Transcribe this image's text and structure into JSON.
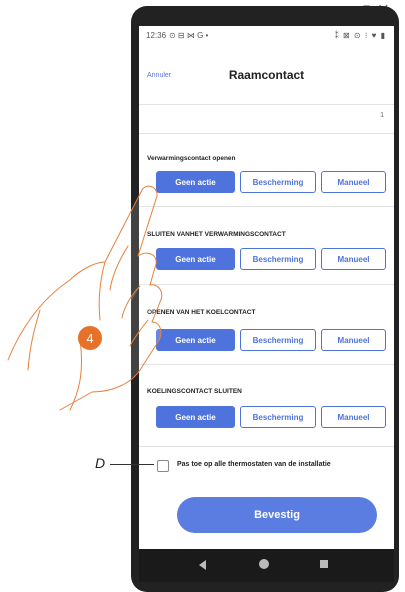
{
  "topbar": {
    "icons_text": "⧉ ✕"
  },
  "statusbar": {
    "time": "12:36",
    "left_icons": "⊙ ⊟ ⋈ G •",
    "right_icons": "⁑ ⊠ ⊙ ⁝ ♥ ▮"
  },
  "header": {
    "cancel_label": "Annuler",
    "title": "Raamcontact"
  },
  "device_number": "1",
  "sections": [
    {
      "label": "Verwarmingscontact openen",
      "options": [
        "Geen actie",
        "Bescherming",
        "Manueel"
      ],
      "selected": "Geen actie"
    },
    {
      "label": "SLUITEN VANHET VERWARMINGSCONTACT",
      "options": [
        "Geen actie",
        "Bescherming",
        "Manueel"
      ],
      "selected": "Geen actie"
    },
    {
      "label": "OPENEN VAN HET KOELCONTACT",
      "options": [
        "Geen actie",
        "Bescherming",
        "Manueel"
      ],
      "selected": "Geen actie"
    },
    {
      "label": "KOELINGSCONTACT SLUITEN",
      "options": [
        "Geen actie",
        "Bescherming",
        "Manueel"
      ],
      "selected": "Geen actie"
    }
  ],
  "apply_all": {
    "label": "Pas toe op alle thermostaten van de installatie",
    "checked": false
  },
  "confirm_label": "Bevestig",
  "annotations": {
    "pointer_letter": "D",
    "step_number": "4"
  },
  "colors": {
    "accent": "#4f73dd",
    "confirm": "#5b7ce0",
    "step_badge": "#e8712a"
  }
}
